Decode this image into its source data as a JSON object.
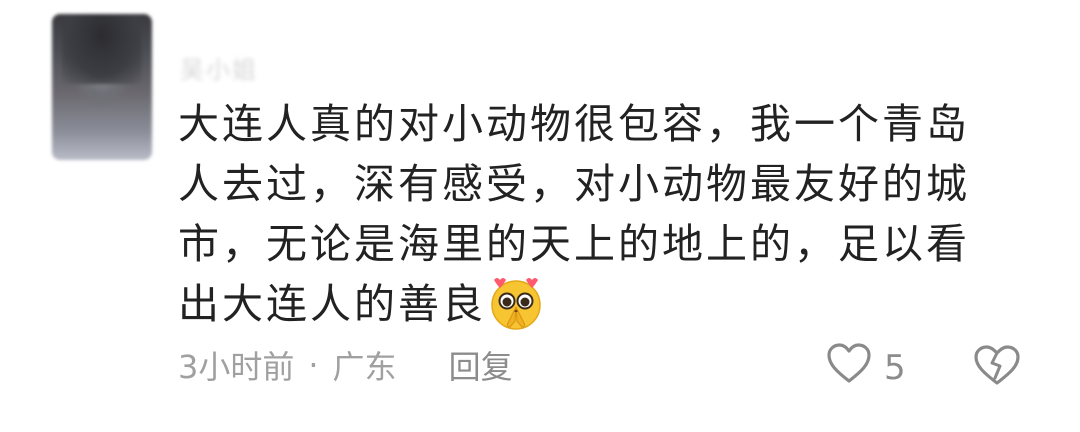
{
  "comment": {
    "username": "吴小姐",
    "text": "大连人真的对小动物很包容，我一个青岛人去过，深有感受，对小动物最友好的城市，无论是海里的天上的地上的，足以看出大连人的善良",
    "emoji": "pleading-face-hands-emoji",
    "time": "3小时前",
    "separator": "·",
    "location": "广东",
    "reply_label": "回复",
    "like_count": "5",
    "icons": {
      "like": "heart-outline-icon",
      "dislike": "broken-heart-icon"
    }
  }
}
